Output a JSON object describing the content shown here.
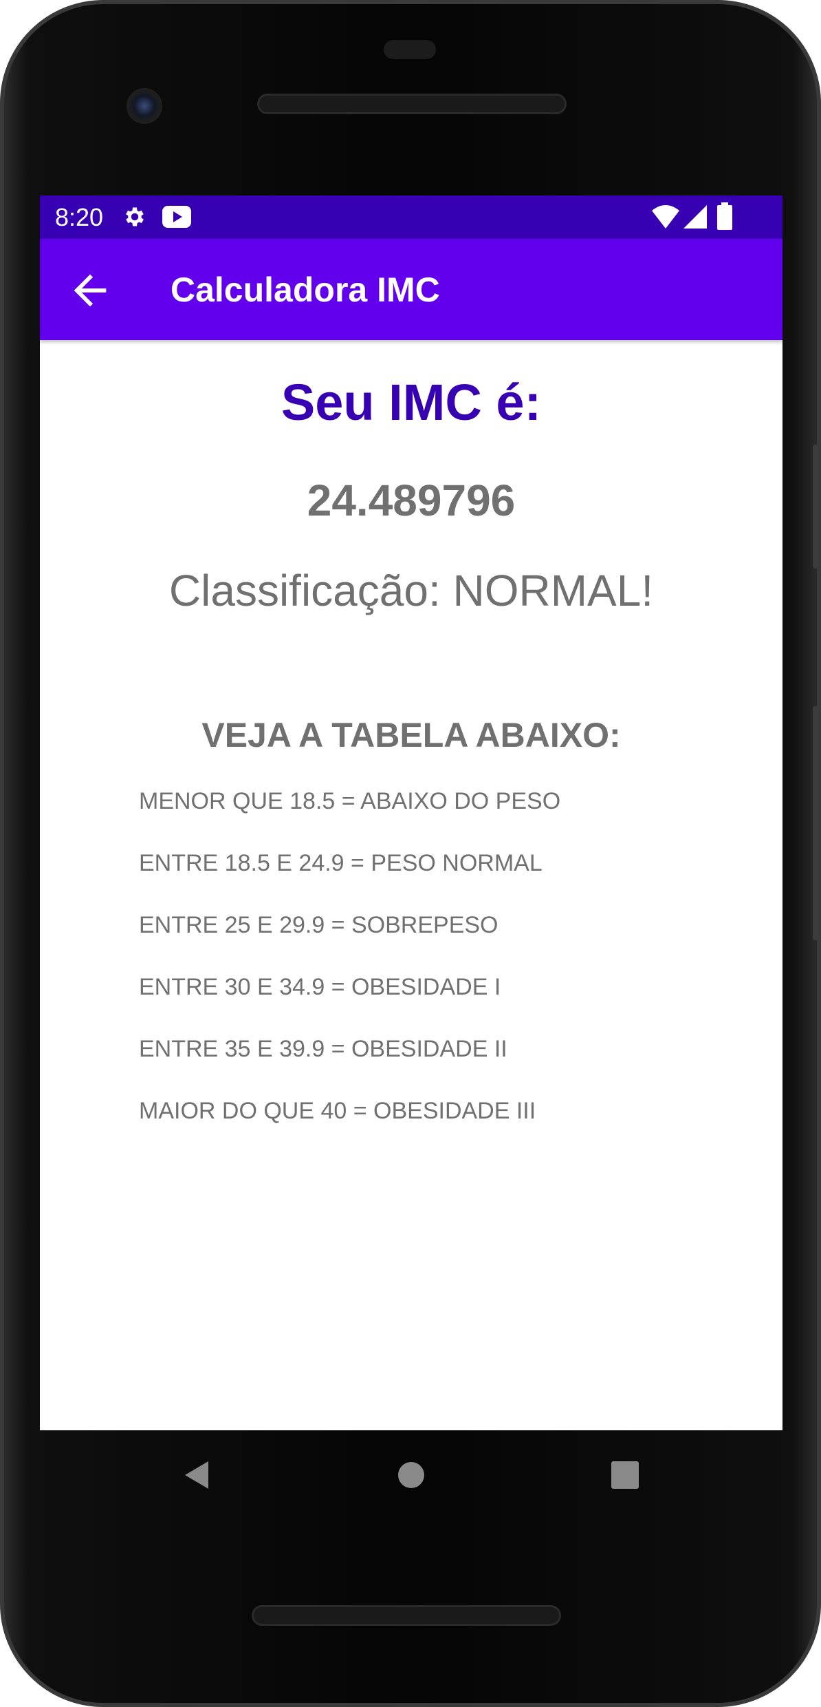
{
  "status_bar": {
    "time": "8:20",
    "left_icons": [
      "gear-icon",
      "youtube-icon"
    ],
    "right_icons": [
      "wifi-icon",
      "signal-icon",
      "battery-icon"
    ],
    "color": "#3700b3"
  },
  "app_bar": {
    "title": "Calculadora IMC",
    "back_icon": "arrow-left-icon",
    "color": "#6200ee"
  },
  "result": {
    "label": "Seu IMC é:",
    "value": "24.489796",
    "classification": "Classificação: NORMAL!"
  },
  "table": {
    "title": "VEJA A TABELA ABAIXO:",
    "rows": [
      "MENOR QUE 18.5 = ABAIXO DO PESO",
      "ENTRE 18.5 E 24.9 = PESO NORMAL",
      "ENTRE 25 E 29.9 = SOBREPESO",
      "ENTRE 30 E 34.9 = OBESIDADE I",
      "ENTRE 35 E 39.9 = OBESIDADE II",
      "MAIOR DO QUE 40 = OBESIDADE III"
    ]
  },
  "nav_bar": {
    "buttons": [
      "back-triangle-icon",
      "home-circle-icon",
      "recents-square-icon"
    ]
  },
  "colors": {
    "primary": "#6200ee",
    "primary_dark": "#3700b3",
    "text_gray": "#707070"
  }
}
